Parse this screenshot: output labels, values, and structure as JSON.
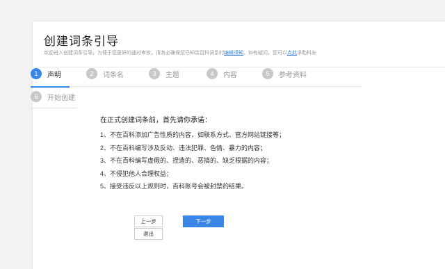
{
  "header": {
    "title": "创建词条引导",
    "subtitle_pre": "欢迎进入创建词条引导。为便于您更好的通过审核，请务必确保您已知晓百科词条的",
    "subtitle_link1": "编辑须知",
    "subtitle_mid": "。如有疑问，您可以",
    "subtitle_link2": "点此",
    "subtitle_post": "求助科友"
  },
  "steps": [
    {
      "num": "1",
      "label": "声明",
      "active": true
    },
    {
      "num": "2",
      "label": "词条名",
      "active": false
    },
    {
      "num": "3",
      "label": "主题",
      "active": false
    },
    {
      "num": "4",
      "label": "内容",
      "active": false
    },
    {
      "num": "5",
      "label": "参考资料",
      "active": false
    },
    {
      "num": "6",
      "label": "开始创建",
      "active": false
    }
  ],
  "content": {
    "lead": "在正式创建词条前，首先请你承诺：",
    "items": [
      "1、不在百科添加广告性质的内容，如联系方式、官方网站链接等；",
      "2、不在百科编写涉及反动、违法犯罪、色情、暴力的内容；",
      "3、不在百科编写虚假的、捏造的、恶搞的、缺乏根据的内容；",
      "4、不侵犯他人合理权益；",
      "5、接受违反以上规则时，百科账号会被封禁的结果。"
    ]
  },
  "buttons": {
    "prev": "上一步",
    "next": "下一步",
    "exit": "退出"
  },
  "colors": {
    "accent": "#3a86e6",
    "inactive_step": "#c8c8c8",
    "link": "#3a7fd5"
  }
}
